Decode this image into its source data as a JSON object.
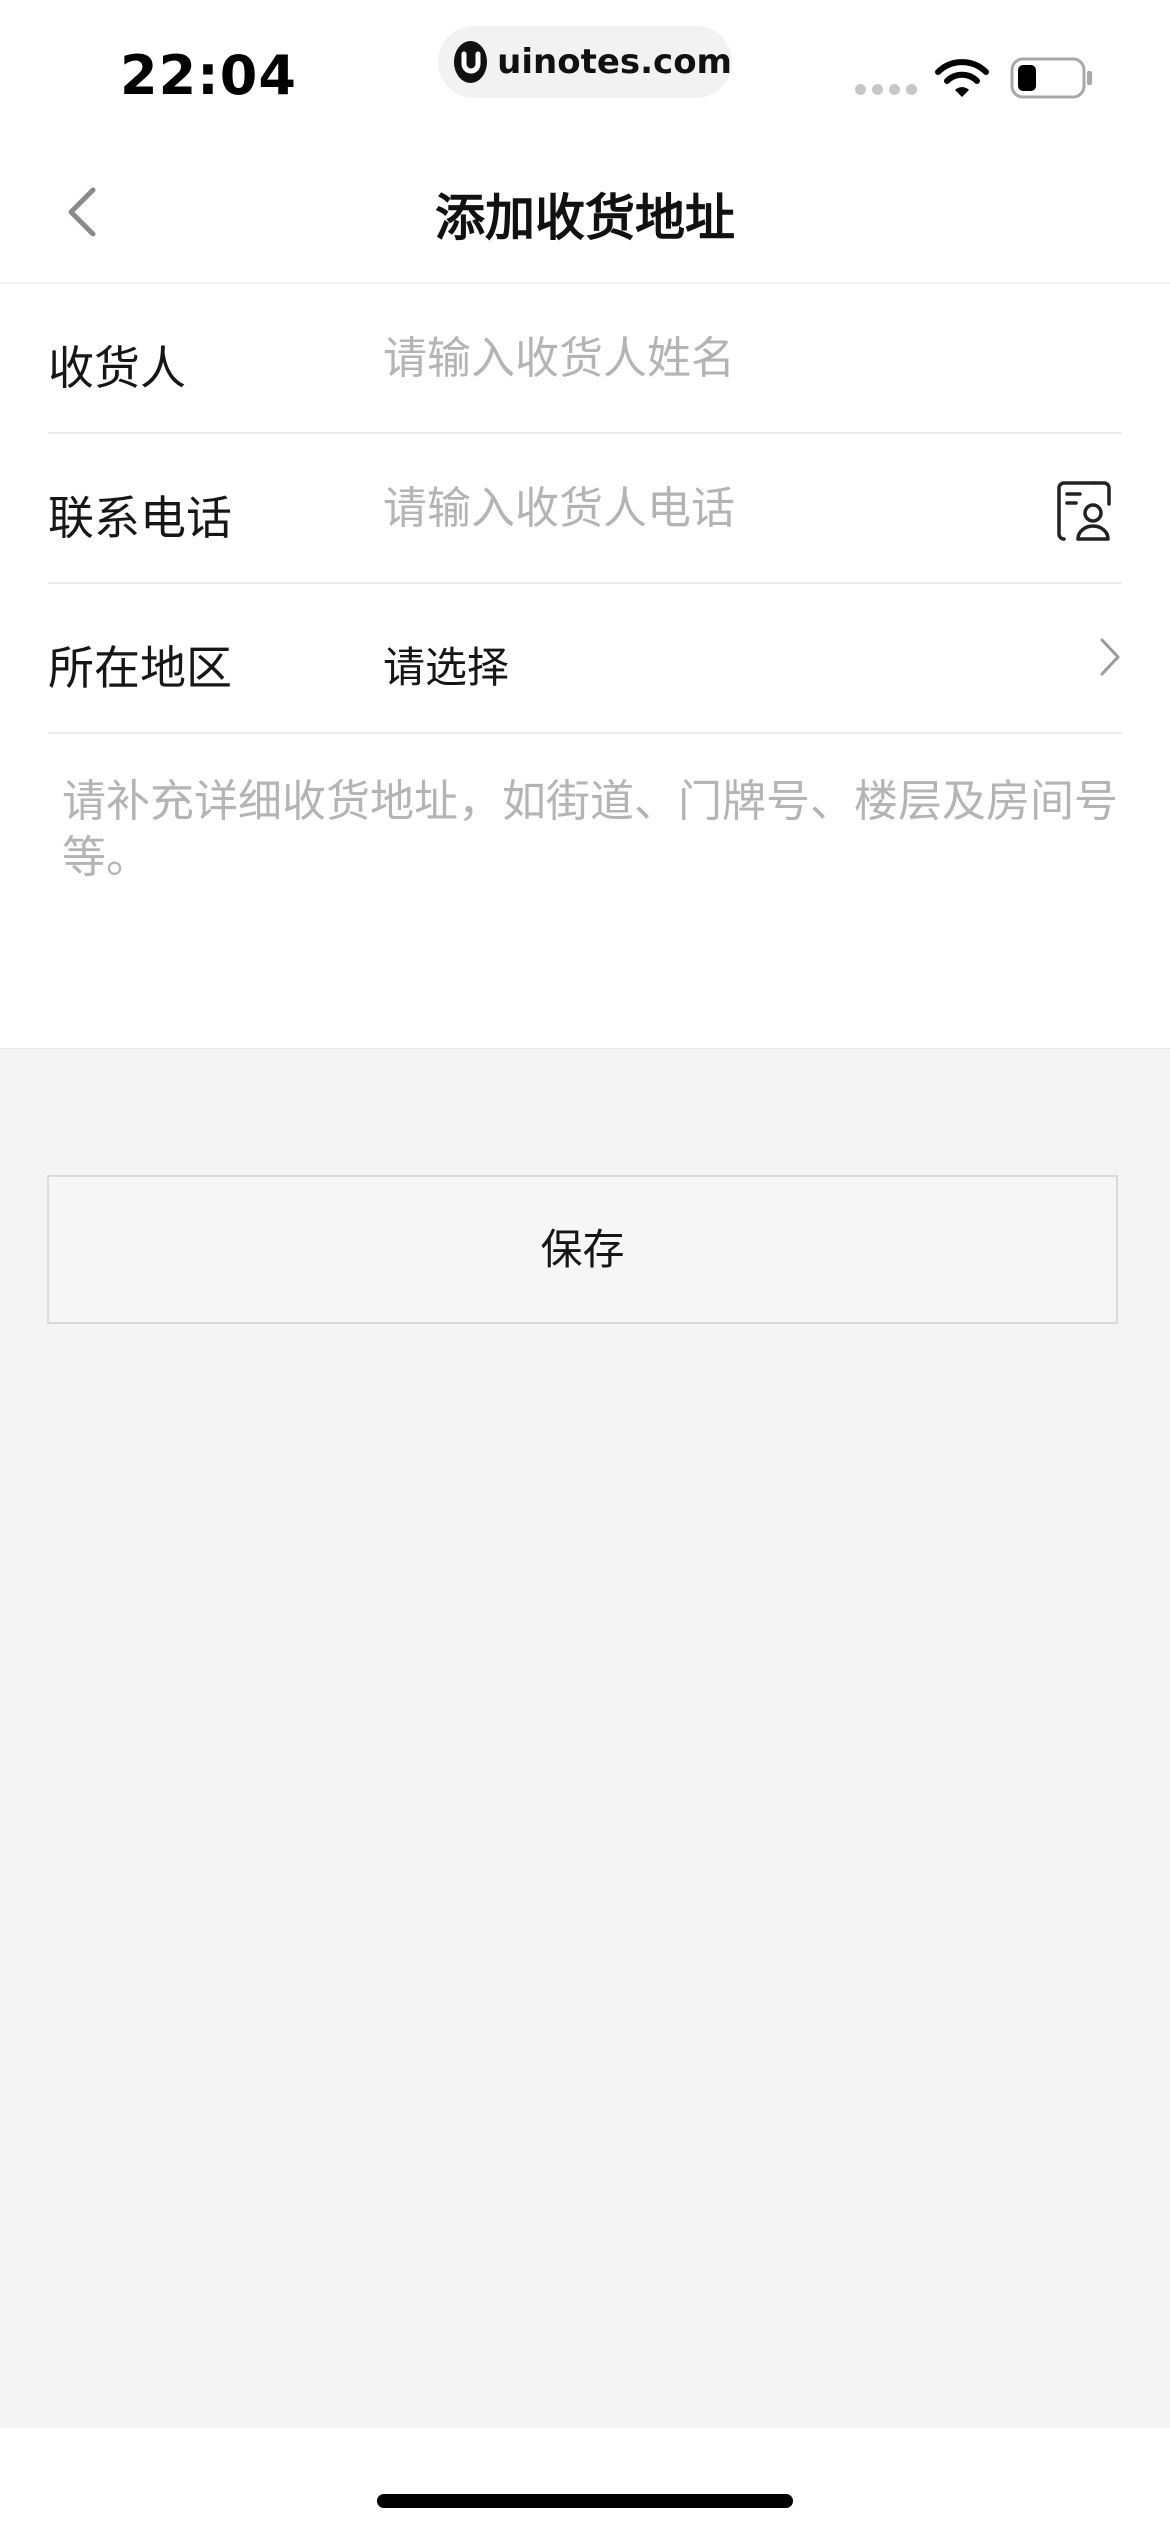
{
  "status_bar": {
    "time": "22:04",
    "url": "uinotes.com",
    "icons": [
      "signal-icon",
      "wifi-icon",
      "battery-icon"
    ]
  },
  "nav": {
    "title": "添加收货地址",
    "back_icon": "chevron-left-icon"
  },
  "form": {
    "name": {
      "label": "收货人",
      "placeholder": "请输入收货人姓名",
      "value": ""
    },
    "phone": {
      "label": "联系电话",
      "placeholder": "请输入收货人电话",
      "value": "",
      "icon": "contacts-icon"
    },
    "region": {
      "label": "所在地区",
      "value": "请选择",
      "icon": "chevron-right-icon"
    },
    "address": {
      "placeholder": "请补充详细收货地址，如街道、门牌号、楼层及房间号等。",
      "value": ""
    }
  },
  "actions": {
    "save_label": "保存"
  },
  "colors": {
    "background": "#f4f4f4",
    "surface": "#ffffff",
    "placeholder": "#b4b4b4",
    "divider": "#ececec",
    "text": "#161616"
  }
}
